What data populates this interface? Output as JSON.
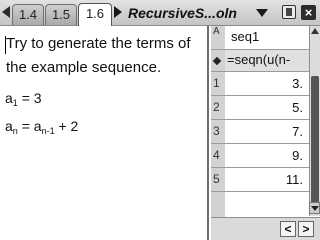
{
  "tabs": [
    {
      "label": "1.4",
      "active": false
    },
    {
      "label": "1.5",
      "active": false
    },
    {
      "label": "1.6",
      "active": true
    }
  ],
  "document": {
    "title": "RecursiveS...oln"
  },
  "notes": {
    "line1": "Try to generate the terms of",
    "line2": "the example sequence.",
    "eq1": {
      "var": "a",
      "sub": "1",
      "rest": " = 3"
    },
    "eq2": {
      "var": "a",
      "sub": "n",
      "mid": " = a",
      "sub2": "n-1",
      "rest": " + 2"
    }
  },
  "spreadsheet": {
    "column_letter": "A",
    "column_name": "seq1",
    "formula": "=seqn(u(n-",
    "rows": [
      {
        "row": "1",
        "value": "3."
      },
      {
        "row": "2",
        "value": "5."
      },
      {
        "row": "3",
        "value": "7."
      },
      {
        "row": "4",
        "value": "9."
      },
      {
        "row": "5",
        "value": "11."
      }
    ]
  },
  "icons": {
    "scroll_left": "left-arrow-icon",
    "scroll_right": "right-arrow-icon",
    "close": "close-icon",
    "battery": "battery-icon"
  }
}
